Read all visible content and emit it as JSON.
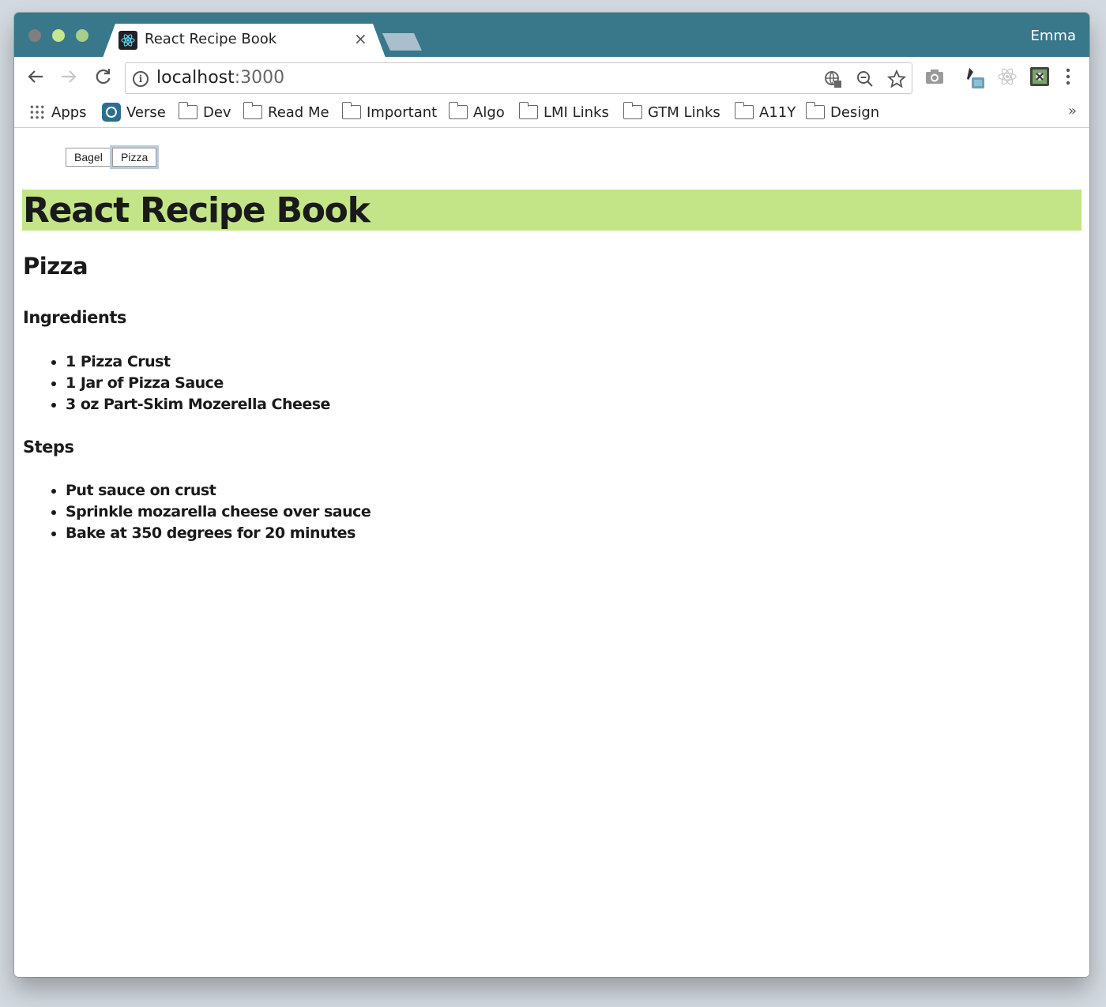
{
  "browser": {
    "tab_title": "React Recipe Book",
    "tab_close": "×",
    "profile_name": "Emma",
    "url_host": "localhost",
    "url_port": ":3000",
    "colors": {
      "titlebar": "#39778b",
      "banner": "#c3e587"
    }
  },
  "bookmarks": {
    "items": [
      {
        "label": "Apps",
        "icon": "apps-grid-icon"
      },
      {
        "label": "Verse",
        "icon": "verse-icon"
      },
      {
        "label": "Dev",
        "icon": "folder-icon"
      },
      {
        "label": "Read Me",
        "icon": "folder-icon"
      },
      {
        "label": "Important",
        "icon": "folder-icon"
      },
      {
        "label": "Algo",
        "icon": "folder-icon"
      },
      {
        "label": "LMI Links",
        "icon": "folder-icon"
      },
      {
        "label": "GTM Links",
        "icon": "folder-icon"
      },
      {
        "label": "A11Y",
        "icon": "folder-icon"
      },
      {
        "label": "Design",
        "icon": "folder-icon"
      }
    ],
    "more": "»"
  },
  "page": {
    "buttons": {
      "bagel": "Bagel",
      "pizza": "Pizza"
    },
    "app_title": "React Recipe Book",
    "recipe": {
      "name": "Pizza",
      "ingredients_heading": "Ingredients",
      "ingredients": [
        "1 Pizza Crust",
        "1 Jar of Pizza Sauce",
        "3 oz Part-Skim Mozerella Cheese"
      ],
      "steps_heading": "Steps",
      "steps": [
        "Put sauce on crust",
        "Sprinkle mozarella cheese over sauce",
        "Bake at 350 degrees for 20 minutes"
      ]
    }
  }
}
